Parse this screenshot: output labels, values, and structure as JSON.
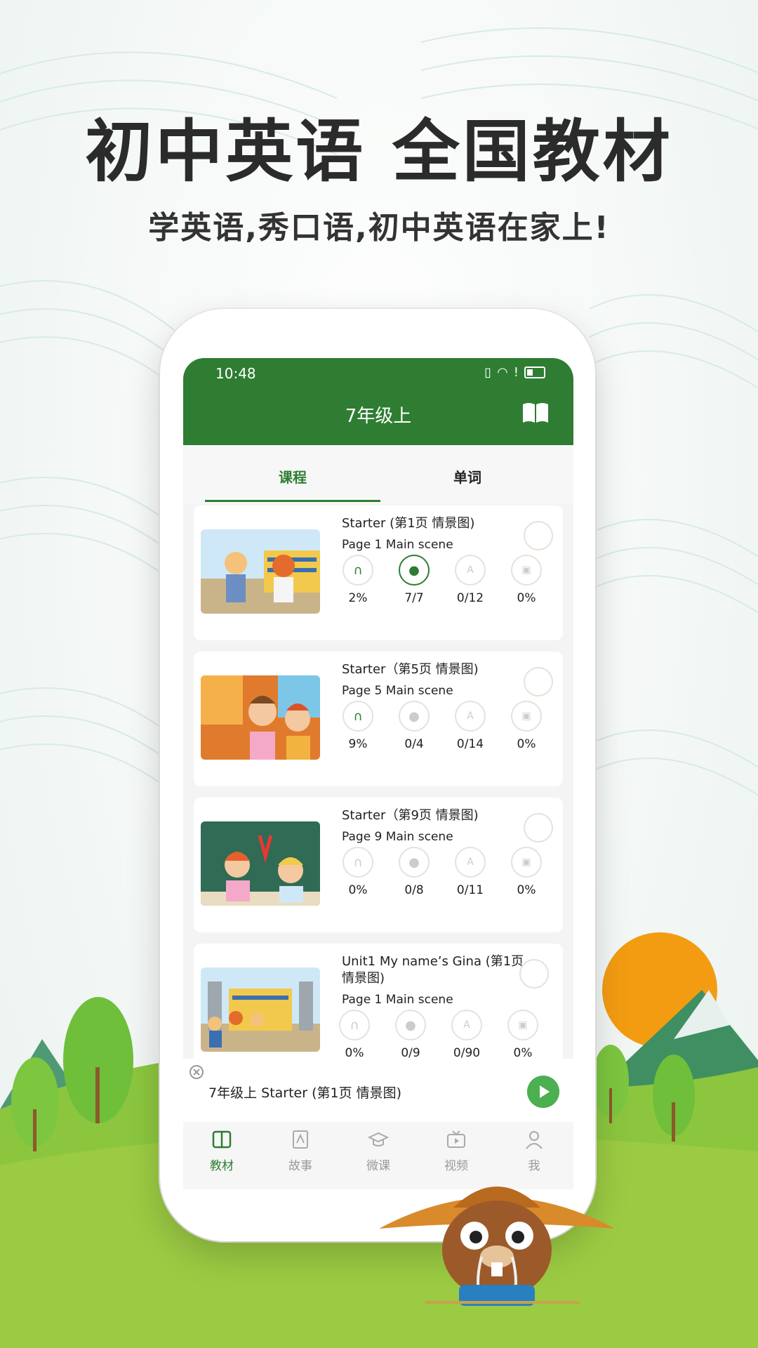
{
  "promo": {
    "headline": "初中英语 全国教材",
    "subline": "学英语,秀口语,初中英语在家上!"
  },
  "status_bar": {
    "time": "10:48"
  },
  "app_bar": {
    "title": "7年级上",
    "book_icon": "open-book-icon"
  },
  "tabs": [
    {
      "label": "课程",
      "active": true
    },
    {
      "label": "单词",
      "active": false
    }
  ],
  "lessons": [
    {
      "title": "Starter (第1页 情景图)",
      "subtitle": "Page 1 Main scene",
      "stats": [
        "2%",
        "7/7",
        "0/12",
        "0%"
      ],
      "listen_progress": 0.02
    },
    {
      "title": "Starter（第5页 情景图)",
      "subtitle": "Page 5 Main scene",
      "stats": [
        "9%",
        "0/4",
        "0/14",
        "0%"
      ],
      "listen_progress": 0.09
    },
    {
      "title": "Starter（第9页 情景图)",
      "subtitle": "Page 9 Main scene",
      "stats": [
        "0%",
        "0/8",
        "0/11",
        "0%"
      ],
      "listen_progress": 0
    },
    {
      "title": "Unit1 My name’s Gina (第1页 情景图)",
      "subtitle": "Page 1 Main scene",
      "stats": [
        "0%",
        "0/9",
        "0/90",
        "0%"
      ],
      "listen_progress": 0
    }
  ],
  "mini_player": {
    "title": "7年级上 Starter (第1页 情景图)"
  },
  "bottom_nav": [
    {
      "label": "教材",
      "icon": "textbook-icon",
      "active": true
    },
    {
      "label": "故事",
      "icon": "story-icon",
      "active": false
    },
    {
      "label": "微课",
      "icon": "graduation-cap-icon",
      "active": false
    },
    {
      "label": "视频",
      "icon": "tv-icon",
      "active": false
    },
    {
      "label": "我",
      "icon": "person-icon",
      "active": false
    }
  ],
  "colors": {
    "brand": "#2e7d32",
    "accent": "#4caf50",
    "sun": "#f39c12"
  }
}
